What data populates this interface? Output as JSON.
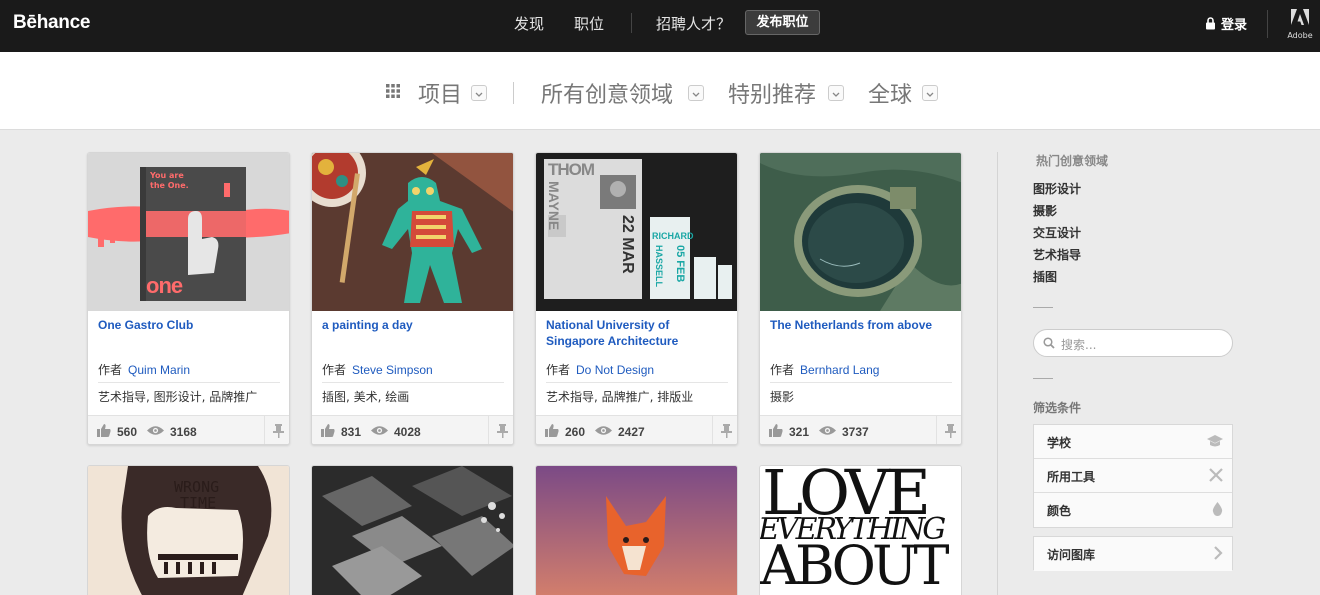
{
  "header": {
    "logo": "Bēhance",
    "nav": [
      "发现",
      "职位"
    ],
    "hire": "招聘人才？",
    "post_job": "发布职位",
    "login": "登录",
    "adobe": "Adobe"
  },
  "filters": {
    "projects": "项目",
    "fields": "所有创意领域",
    "featured": "特别推荐",
    "global": "全球"
  },
  "projects": [
    {
      "title": "One Gastro Club",
      "author_prefix": "作者",
      "author": "Quim Marin",
      "tags": "艺术指导, 图形设计, 品牌推广",
      "likes": "560",
      "views": "3168"
    },
    {
      "title": "a painting a day",
      "author_prefix": "作者",
      "author": "Steve Simpson",
      "tags": "插图, 美术, 绘画",
      "likes": "831",
      "views": "4028"
    },
    {
      "title": "National University of Singapore Architecture",
      "author_prefix": "作者",
      "author": "Do Not Design",
      "tags": "艺术指导, 品牌推广, 排版业",
      "likes": "260",
      "views": "2427"
    },
    {
      "title": "The Netherlands from above",
      "author_prefix": "作者",
      "author": "Bernhard Lang",
      "tags": "摄影",
      "likes": "321",
      "views": "3737"
    }
  ],
  "thumbs": {
    "one_text": "You are the One.",
    "one_logo": "one",
    "thom": "THOM",
    "mayne": "MAYNE",
    "date_22": "22 MAR",
    "richard": "RICHARD",
    "hassell": "HASSELL",
    "feb": "05 FEB",
    "wrong": "WRONG",
    "time": "TIME",
    "love": "LOVE",
    "everything": "EVERYTHING",
    "about": "ABOUT"
  },
  "sidebar": {
    "popular_heading": "热门创意领域",
    "popular": [
      "图形设计",
      "摄影",
      "交互设计",
      "艺术指导",
      "插图"
    ],
    "search_placeholder": "搜索...",
    "filter_heading": "筛选条件",
    "filters": [
      "学校",
      "所用工具",
      "颜色"
    ],
    "gallery": "访问图库"
  }
}
